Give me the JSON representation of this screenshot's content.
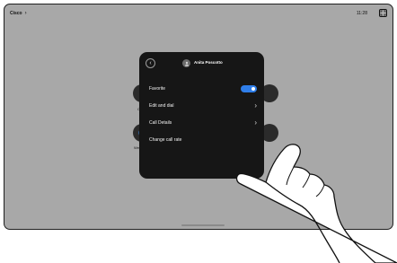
{
  "topbar": {
    "brand": "Cisco",
    "brand_chevron": "›",
    "time": "11:28",
    "corner_icon": "fullscreen-icon"
  },
  "background_labels": {
    "left_top": "C",
    "left_bottom": "We"
  },
  "panel": {
    "back_icon": "‹",
    "contact_name": "Anita Poscotto",
    "items": [
      {
        "label": "Favorite",
        "control": "toggle",
        "toggle_on": true
      },
      {
        "label": "Edit and dial",
        "control": "chevron",
        "chevron": "›"
      },
      {
        "label": "Call Details",
        "control": "chevron",
        "chevron": "›"
      },
      {
        "label": "Change call rate",
        "control": "none"
      }
    ]
  },
  "colors": {
    "screen_bg": "#a8a8a8",
    "panel_bg": "#161616",
    "toggle_on": "#2f7ee9",
    "blue_button": "#2f7ee9"
  }
}
